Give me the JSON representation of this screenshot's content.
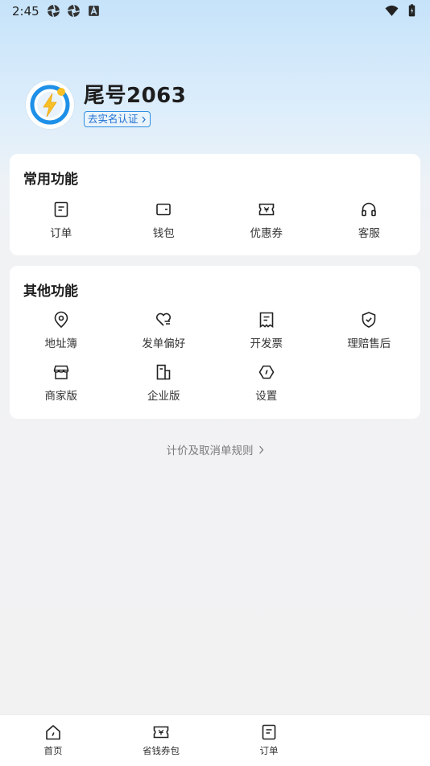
{
  "status_bar": {
    "time": "2:45"
  },
  "profile": {
    "username": "尾号2063",
    "verify_label": "去实名认证"
  },
  "common_functions": {
    "title": "常用功能",
    "items": [
      {
        "label": "订单",
        "icon": "order-icon"
      },
      {
        "label": "钱包",
        "icon": "wallet-icon"
      },
      {
        "label": "优惠券",
        "icon": "coupon-icon"
      },
      {
        "label": "客服",
        "icon": "headset-icon"
      }
    ]
  },
  "other_functions": {
    "title": "其他功能",
    "items": [
      {
        "label": "地址簿",
        "icon": "location-pin-icon"
      },
      {
        "label": "发单偏好",
        "icon": "heart-list-icon"
      },
      {
        "label": "开发票",
        "icon": "invoice-icon"
      },
      {
        "label": "理赔售后",
        "icon": "shield-check-icon"
      },
      {
        "label": "商家版",
        "icon": "store-icon"
      },
      {
        "label": "企业版",
        "icon": "building-icon"
      },
      {
        "label": "设置",
        "icon": "settings-icon"
      }
    ]
  },
  "rules_link": "计价及取消单规则",
  "bottom_nav": [
    {
      "label": "首页",
      "icon": "home-icon"
    },
    {
      "label": "省钱券包",
      "icon": "coupon-icon"
    },
    {
      "label": "订单",
      "icon": "order-icon"
    }
  ],
  "colors": {
    "accent": "#1e90e8",
    "badge": "#2f8fe0",
    "bolt": "#f6c026"
  }
}
